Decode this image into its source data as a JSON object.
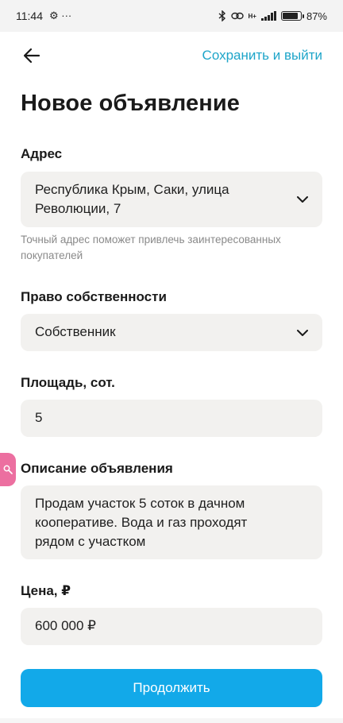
{
  "status_bar": {
    "time": "11:44",
    "extra_icons": "⚙ ···",
    "network_label": "H+",
    "battery_percent": "87%",
    "battery_level": 0.87
  },
  "nav": {
    "save_exit_label": "Сохранить и выйти"
  },
  "page": {
    "title": "Новое объявление"
  },
  "form": {
    "address": {
      "label": "Адрес",
      "line1": "Республика Крым, Саки, улица",
      "line2": "Революции, 7",
      "hint_line1": "Точный адрес поможет привлечь заинтересованных",
      "hint_line2": "покупателей"
    },
    "ownership": {
      "label": "Право собственности",
      "value": "Собственник"
    },
    "area": {
      "label": "Площадь, сот.",
      "value": "5"
    },
    "description": {
      "label": "Описание объявления",
      "line1": "Продам участок 5 соток  в дачном",
      "line2": "кооперативе. Вода и газ проходят",
      "line3": "рядом с участком"
    },
    "price": {
      "label": "Цена, ₽",
      "value": "600 000 ₽"
    }
  },
  "actions": {
    "continue_label": "Продолжить"
  },
  "colors": {
    "accent_link": "#1ea5c9",
    "primary_button": "#12a9e9",
    "field_background": "#f2f1ef",
    "side_tab": "#ec6fa0"
  }
}
